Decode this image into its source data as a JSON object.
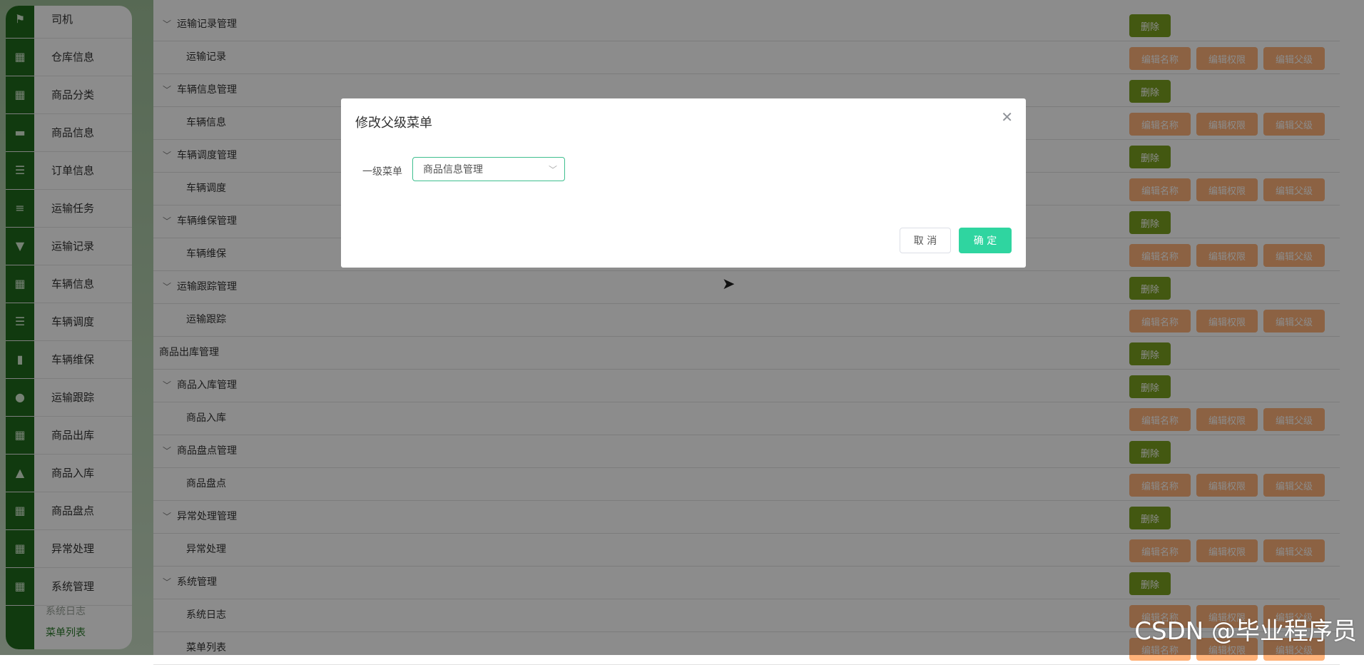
{
  "sidebar": {
    "items": [
      {
        "label": "司机",
        "icon": "flag-icon"
      },
      {
        "label": "仓库信息",
        "icon": "grid-icon"
      },
      {
        "label": "商品分类",
        "icon": "grid-icon"
      },
      {
        "label": "商品信息",
        "icon": "ticket-icon"
      },
      {
        "label": "订单信息",
        "icon": "list-icon"
      },
      {
        "label": "运输任务",
        "icon": "sliders-icon"
      },
      {
        "label": "运输记录",
        "icon": "sign-icon"
      },
      {
        "label": "车辆信息",
        "icon": "grid-icon"
      },
      {
        "label": "车辆调度",
        "icon": "list-icon"
      },
      {
        "label": "车辆维保",
        "icon": "bar-chart-icon"
      },
      {
        "label": "运输跟踪",
        "icon": "user-icon"
      },
      {
        "label": "商品出库",
        "icon": "grid-icon"
      },
      {
        "label": "商品入库",
        "icon": "thumb-up-icon"
      },
      {
        "label": "商品盘点",
        "icon": "grid-icon"
      },
      {
        "label": "异常处理",
        "icon": "grid-icon"
      },
      {
        "label": "系统管理",
        "icon": "grid-icon"
      }
    ],
    "subitems": [
      {
        "label": "系统日志"
      },
      {
        "label": "菜单列表"
      }
    ]
  },
  "table": {
    "rows": [
      {
        "name": "运输记录管理",
        "level": "parent"
      },
      {
        "name": "运输记录",
        "level": "child"
      },
      {
        "name": "车辆信息管理",
        "level": "parent"
      },
      {
        "name": "车辆信息",
        "level": "child"
      },
      {
        "name": "车辆调度管理",
        "level": "parent"
      },
      {
        "name": "车辆调度",
        "level": "child"
      },
      {
        "name": "车辆维保管理",
        "level": "parent"
      },
      {
        "name": "车辆维保",
        "level": "child"
      },
      {
        "name": "运输跟踪管理",
        "level": "parent"
      },
      {
        "name": "运输跟踪",
        "level": "child"
      },
      {
        "name": "商品出库管理",
        "level": "top"
      },
      {
        "name": "商品入库管理",
        "level": "parent"
      },
      {
        "name": "商品入库",
        "level": "child"
      },
      {
        "name": "商品盘点管理",
        "level": "parent"
      },
      {
        "name": "商品盘点",
        "level": "child"
      },
      {
        "name": "异常处理管理",
        "level": "parent"
      },
      {
        "name": "异常处理",
        "level": "child"
      },
      {
        "name": "系统管理",
        "level": "parent"
      },
      {
        "name": "系统日志",
        "level": "child"
      },
      {
        "name": "菜单列表",
        "level": "child"
      }
    ],
    "actions": {
      "delete": "删除",
      "edit_name": "编辑名称",
      "edit_perm": "编辑权限",
      "edit_parent": "编辑父级"
    }
  },
  "dialog": {
    "title": "修改父级菜单",
    "field_label": "一级菜单",
    "selected": "商品信息管理",
    "cancel": "取 消",
    "confirm": "确 定"
  },
  "watermark": "CSDN @毕业程序员",
  "colors": {
    "rail": "#1f6b1d",
    "delete_btn": "#7aa11f",
    "edit_btn": "#ffb37a",
    "confirm_btn": "#2fd5a0"
  }
}
